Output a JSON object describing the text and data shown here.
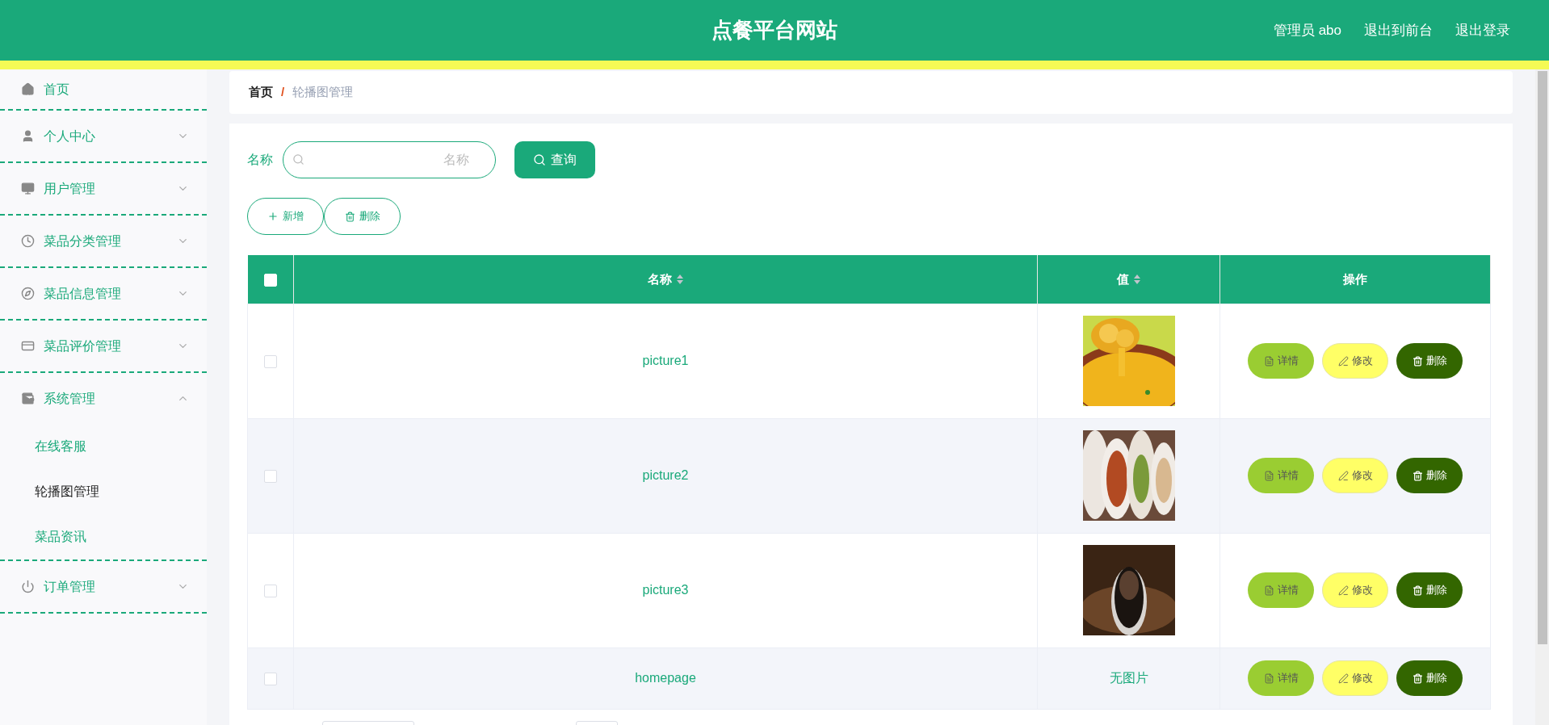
{
  "header": {
    "title": "点餐平台网站",
    "links": [
      "管理员 abo",
      "退出到前台",
      "退出登录"
    ]
  },
  "sidebar": {
    "items": [
      {
        "label": "首页"
      },
      {
        "label": "个人中心",
        "expanded": false
      },
      {
        "label": "用户管理",
        "expanded": false
      },
      {
        "label": "菜品分类管理",
        "expanded": false
      },
      {
        "label": "菜品信息管理",
        "expanded": false
      },
      {
        "label": "菜品评价管理",
        "expanded": false
      },
      {
        "label": "系统管理",
        "expanded": true,
        "children": [
          {
            "label": "在线客服",
            "selected": false
          },
          {
            "label": "轮播图管理",
            "selected": true
          },
          {
            "label": "菜品资讯",
            "selected": false
          }
        ]
      },
      {
        "label": "订单管理",
        "expanded": false
      }
    ]
  },
  "breadcrumb": {
    "separator": "/",
    "items": [
      "首页",
      "轮播图管理"
    ]
  },
  "search": {
    "label": "名称",
    "placeholder": "名称",
    "button": "查询"
  },
  "toolbar": [
    {
      "kind": "add",
      "label": "新增"
    },
    {
      "kind": "delete",
      "label": "删除"
    }
  ],
  "table": {
    "select_all_checked": false,
    "columns": [
      {
        "label": "名称",
        "sortable": true
      },
      {
        "label": "值",
        "sortable": true
      },
      {
        "label": "操作",
        "sortable": false
      }
    ],
    "rows": [
      {
        "checked": false,
        "name": "picture1",
        "value": {
          "kind": "picture"
        },
        "actions": [
          {
            "kind": "detail",
            "label": "详情"
          },
          {
            "kind": "edit",
            "label": "修改"
          },
          {
            "kind": "delete",
            "label": "删除"
          }
        ]
      },
      {
        "checked": false,
        "name": "picture2",
        "value": {
          "kind": "picture"
        },
        "actions": [
          {
            "kind": "detail",
            "label": "详情"
          },
          {
            "kind": "edit",
            "label": "修改"
          },
          {
            "kind": "delete",
            "label": "删除"
          }
        ]
      },
      {
        "checked": false,
        "name": "picture3",
        "value": {
          "kind": "picture"
        },
        "actions": [
          {
            "kind": "detail",
            "label": "详情"
          },
          {
            "kind": "edit",
            "label": "修改"
          },
          {
            "kind": "delete",
            "label": "删除"
          }
        ]
      },
      {
        "checked": false,
        "name": "homepage",
        "value": {
          "kind": "text",
          "text": "无图片"
        },
        "actions": [
          {
            "kind": "detail",
            "label": "详情"
          },
          {
            "kind": "edit",
            "label": "修改"
          },
          {
            "kind": "delete",
            "label": "删除"
          }
        ]
      }
    ]
  }
}
